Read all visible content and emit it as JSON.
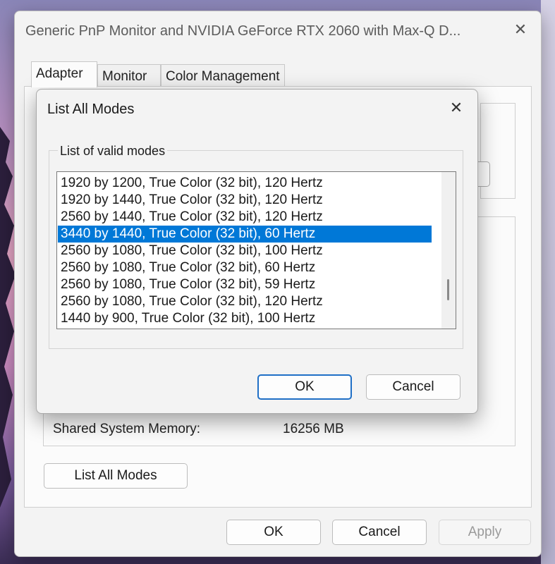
{
  "window": {
    "title": "Generic PnP Monitor and NVIDIA GeForce RTX 2060 with Max-Q D...",
    "close_glyph": "✕",
    "tabs": [
      "Adapter",
      "Monitor",
      "Color Management"
    ],
    "info": {
      "label": "Shared System Memory:",
      "value": "16256 MB"
    },
    "list_all_modes_label": "List All Modes",
    "buttons": {
      "ok": "OK",
      "cancel": "Cancel",
      "apply": "Apply"
    }
  },
  "dialog": {
    "title": "List All Modes",
    "close_glyph": "✕",
    "group_label": "List of valid modes",
    "selected_index": 3,
    "modes": [
      "1920 by 1200, True Color (32 bit), 120 Hertz",
      "1920 by 1440, True Color (32 bit), 120 Hertz",
      "2560 by 1440, True Color (32 bit), 120 Hertz",
      "3440 by 1440, True Color (32 bit), 60 Hertz",
      "2560 by 1080, True Color (32 bit), 100 Hertz",
      "2560 by 1080, True Color (32 bit), 60 Hertz",
      "2560 by 1080, True Color (32 bit), 59 Hertz",
      "2560 by 1080, True Color (32 bit), 120 Hertz",
      "1440 by 900, True Color (32 bit), 100 Hertz"
    ],
    "buttons": {
      "ok": "OK",
      "cancel": "Cancel"
    }
  },
  "colors": {
    "selection": "#0078d7",
    "focus_border": "#1f6fc6",
    "window_bg": "#f3f3f3"
  }
}
